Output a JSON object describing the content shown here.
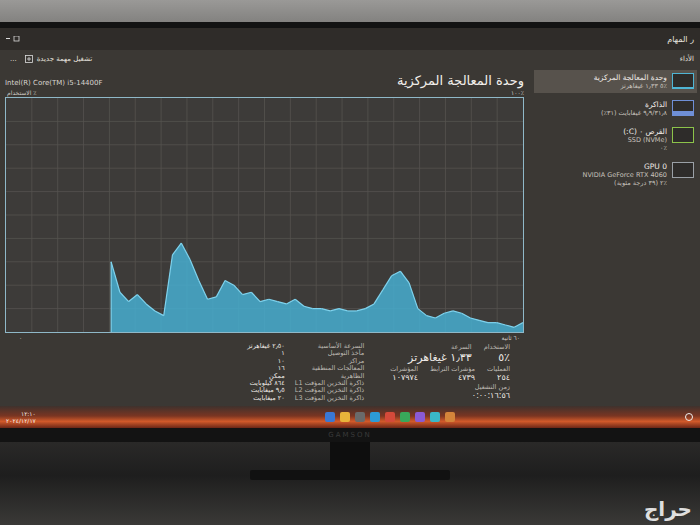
{
  "window": {
    "title": "ر المهام",
    "new_task": "تشغيل مهمة جديدة",
    "more": "..."
  },
  "nav": {
    "section": "الأداء"
  },
  "sidebar": {
    "items": [
      {
        "name": "وحدة المعالجة المركزية",
        "detail": "٪٥ ١٫٣٣ غيغاهرتز",
        "selected": true,
        "level": 0.05,
        "color": "#4fb5d5"
      },
      {
        "name": "الذاكرة",
        "detail": "٩٫٩/٣١٫٨ غيغابايت (٣١٪)",
        "selected": false,
        "level": 0.31,
        "color": "#6f8fd6"
      },
      {
        "name": "القرص ٠ (C:)",
        "detail": "SSD (NVMe)",
        "extra": "٪٠",
        "selected": false,
        "level": 0.02,
        "color": "#8cc34a"
      },
      {
        "name": "GPU 0",
        "detail": "NVIDIA GeForce RTX 4060",
        "extra": "٪٢ (٣٩ درجة مئوية)",
        "selected": false,
        "level": 0.02,
        "color": "#9aa0a6"
      }
    ]
  },
  "header": {
    "title": "وحدة المعالجة المركزية",
    "processor": "Intel(R) Core(TM) i5-14400F"
  },
  "chart": {
    "y_label": "الاستخدام ٪",
    "y_max": "١٠٠٪",
    "x_start": "٦٠ ثانية",
    "x_end": "٠",
    "series": [
      {
        "name": "الاستخدام",
        "values": [
          30,
          17,
          13,
          16,
          12,
          9,
          7,
          33,
          38,
          31,
          22,
          14,
          15,
          22,
          20,
          16,
          17,
          13,
          14,
          13,
          12,
          14,
          11,
          10,
          10,
          9,
          10,
          9,
          9,
          10,
          12,
          18,
          24,
          26,
          21,
          10,
          7,
          6,
          8,
          9,
          8,
          6,
          5,
          4,
          4,
          3,
          2,
          4
        ]
      }
    ]
  },
  "stats": {
    "rows": [
      [
        {
          "label": "الاستخدام",
          "value": "٪٥"
        },
        {
          "label": "السرعة",
          "value": "١٫٣٣ غيغاهرتز"
        }
      ],
      [
        {
          "label": "العمليات",
          "value": "٢٥٤"
        },
        {
          "label": "مؤشرات الترابط",
          "value": "٤٧٣٩"
        },
        {
          "label": "المؤشرات",
          "value": "١٠٧٩٧٤"
        }
      ],
      [
        {
          "label": "زمن التشغيل",
          "value": "٠:٠٠:١٦:٥٦"
        }
      ]
    ]
  },
  "specs": [
    {
      "label": "السرعة الأساسية",
      "value": "٢٫٥٠ غيغاهرتز"
    },
    {
      "label": "مآخذ التوصيل",
      "value": "١"
    },
    {
      "label": "مراكز",
      "value": "١٠"
    },
    {
      "label": "المعالجات المنطقية",
      "value": "١٦"
    },
    {
      "label": "الظاهرية",
      "value": "ممكن"
    },
    {
      "label": "ذاكرة التخزين المؤقت L1",
      "value": "٨٦٤ كيلوبايت"
    },
    {
      "label": "ذاكرة التخزين المؤقت L2",
      "value": "٩٫٥ ميغابايت"
    },
    {
      "label": "ذاكرة التخزين المؤقت L3",
      "value": "٢٠ ميغابايت"
    }
  ],
  "taskbar": {
    "time": "١٢:١٠",
    "date": "٢٠٢٤/١٢/١٧"
  },
  "monitor": {
    "brand": "GAMSON"
  },
  "watermark": "حراج"
}
